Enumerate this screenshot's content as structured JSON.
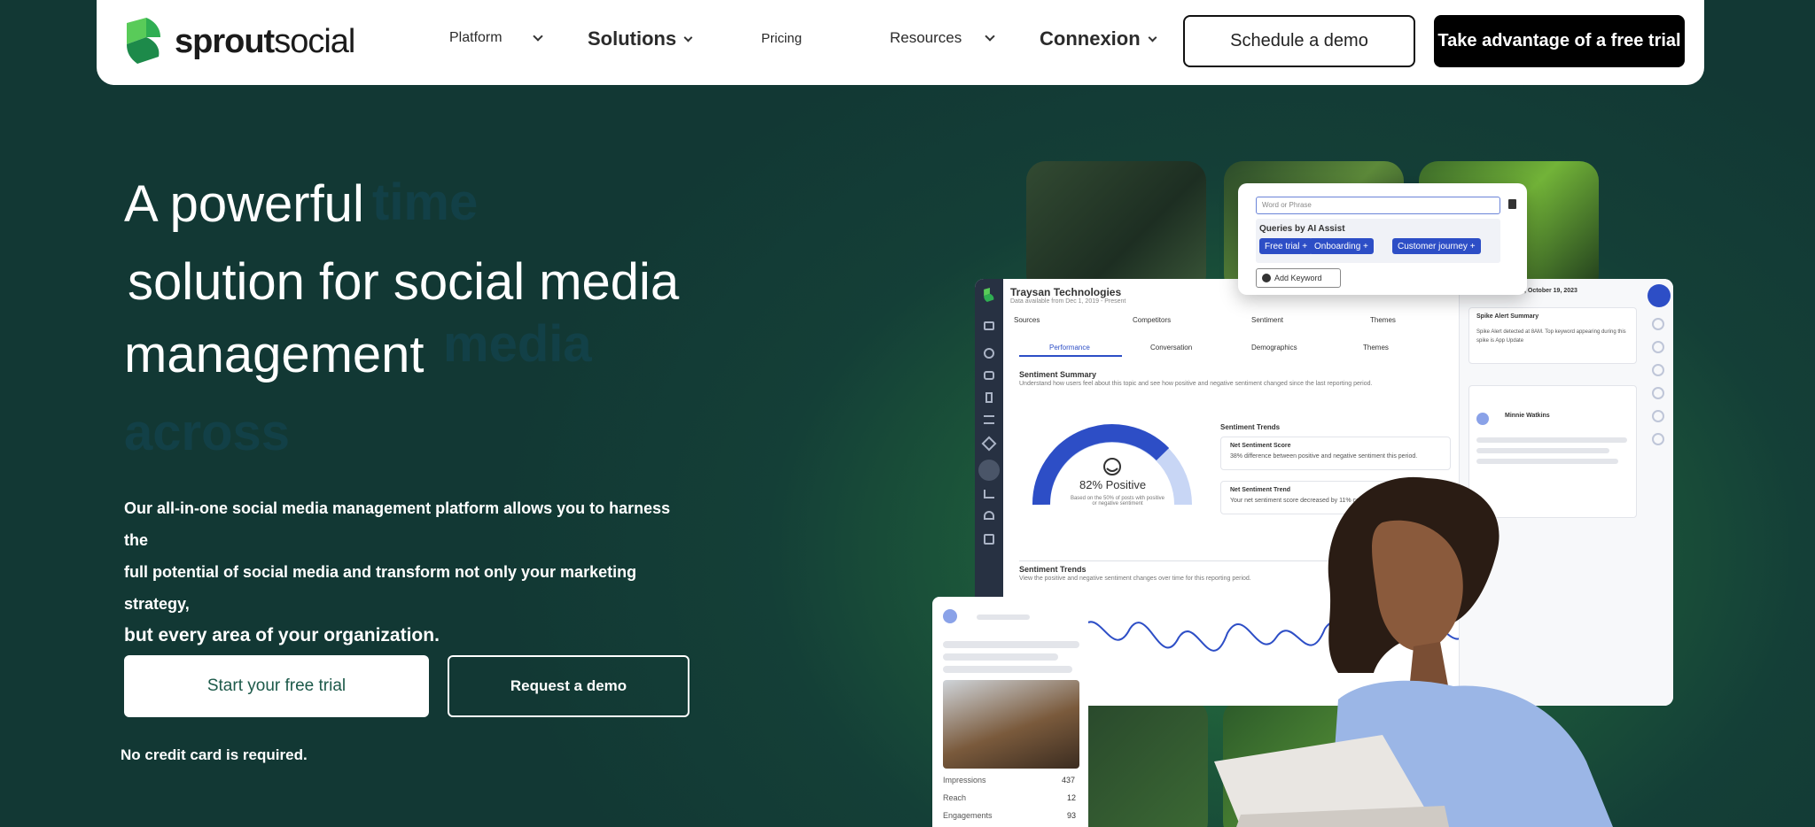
{
  "nav": {
    "logo_bold": "sprout",
    "logo_light": "social",
    "items": [
      {
        "label": "Platform"
      },
      {
        "label": "Solutions"
      },
      {
        "label": "Pricing"
      },
      {
        "label": "Resources"
      },
      {
        "label": "Connexion"
      }
    ],
    "schedule_demo": "Schedule a demo",
    "free_trial": "Take advantage of a free trial"
  },
  "hero": {
    "title_line1": "A powerful",
    "title_line2": "solution for social media",
    "title_line3": "management",
    "desc_line1": "Our all-in-one social media management platform allows you to harness the",
    "desc_line2": "full potential of social media and transform not only your marketing strategy,",
    "desc_line3": "but every area of your organization.",
    "start_trial": "Start your free trial",
    "request_demo": "Request a demo",
    "no_credit_card": "No credit card is required."
  },
  "visual": {
    "keyword_placeholder": "Word or Phrase",
    "queries_title": "Queries by AI Assist",
    "chips": [
      "Free trial +",
      "Onboarding +",
      "Customer journey +"
    ],
    "add_keyword": "Add Keyword",
    "company": "Traysan Technologies",
    "company_sub": "Data available from Dec 1, 2019 - Present",
    "filters": [
      "Sources",
      "Competitors",
      "Sentiment",
      "Themes"
    ],
    "tabs": [
      "Performance",
      "Conversation",
      "Demographics",
      "Themes"
    ],
    "sentiment_summary": "Sentiment Summary",
    "sentiment_summary_sub": "Understand how users feel about this topic and see how positive and negative sentiment changed since the last reporting period.",
    "positive_pct": "82% Positive",
    "positive_note": "Based on the 50% of posts with positive or negative sentiment",
    "sentiment_trends": "Sentiment Trends",
    "net_score": "Net Sentiment Score",
    "net_score_sub": "38% difference between positive and negative sentiment this period.",
    "net_trend": "Net Sentiment Trend",
    "net_trend_sub": "Your net sentiment score decreased by 11% compared to the previous period.",
    "trends_title": "Sentiment Trends",
    "trends_sub": "View the positive and negative sentiment changes over time for this reporting period.",
    "date": "Thursday, October 19, 2023",
    "spike_title": "Spike Alert Summary",
    "spike_text": "Spike Alert detected at 8AM. Top keyword appearing during this spike is App Update",
    "mentioner": "Minnie Watkins",
    "stats": [
      {
        "label": "Impressions",
        "value": "437"
      },
      {
        "label": "Reach",
        "value": "12"
      },
      {
        "label": "Engagements",
        "value": "93"
      }
    ]
  }
}
